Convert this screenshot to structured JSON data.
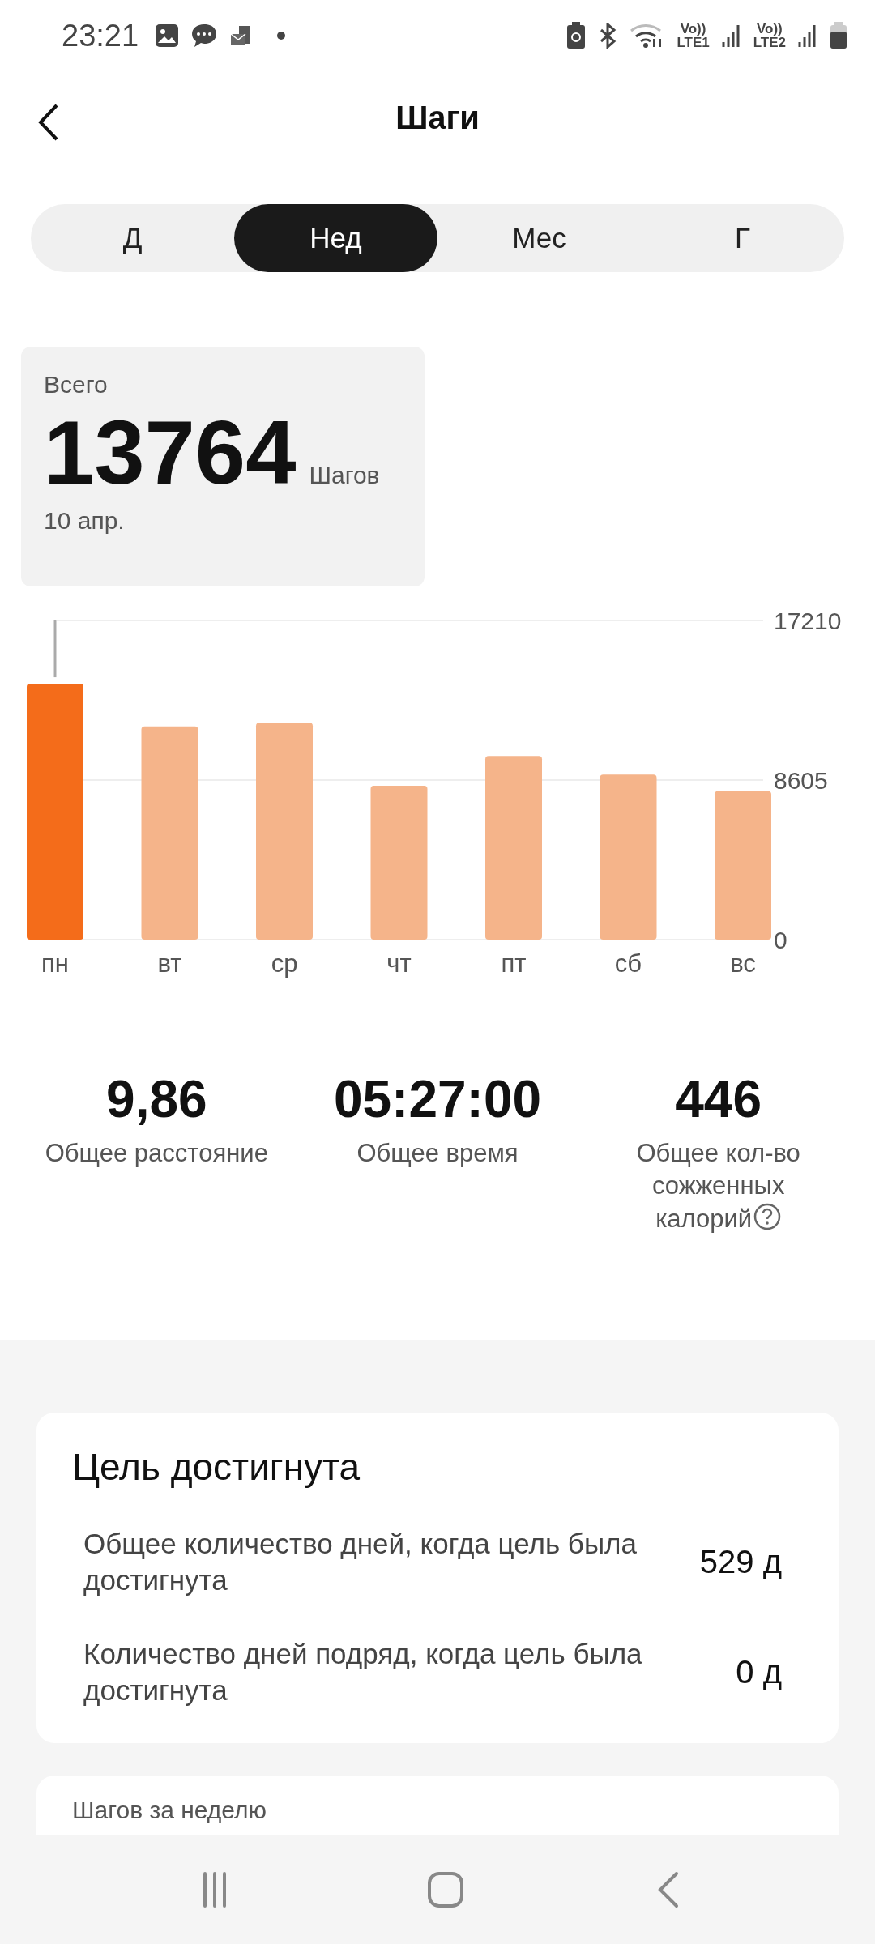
{
  "status_bar": {
    "time": "23:21",
    "network_labels": [
      {
        "top": "Vo))",
        "bottom": "LTE1"
      },
      {
        "top": "Vo))",
        "bottom": "LTE2"
      }
    ]
  },
  "header": {
    "title": "Шаги"
  },
  "tabs": [
    {
      "label": "Д",
      "selected": false
    },
    {
      "label": "Нед",
      "selected": true
    },
    {
      "label": "Мес",
      "selected": false
    },
    {
      "label": "Г",
      "selected": false
    }
  ],
  "summary": {
    "caption": "Всего",
    "value": "13764",
    "unit": "Шагов",
    "date": "10 апр."
  },
  "chart_data": {
    "type": "bar",
    "categories": [
      "пн",
      "вт",
      "ср",
      "чт",
      "пт",
      "сб",
      "вс"
    ],
    "series": [
      {
        "color": "#f46c1a",
        "values": [
          13800,
          null,
          null,
          null,
          null,
          null,
          null
        ]
      },
      {
        "color": "#f5b48a",
        "values": [
          null,
          11500,
          11700,
          8300,
          9900,
          8900,
          8000
        ]
      }
    ],
    "ylim": [
      0,
      17210
    ],
    "yticks": [
      0,
      8605,
      17210
    ]
  },
  "stats": [
    {
      "value": "9,86",
      "label": "Общее расстояние",
      "help": false
    },
    {
      "value": "05:27:00",
      "label": "Общее время",
      "help": false
    },
    {
      "value": "446",
      "label": "Общее кол-во сожженных калорий",
      "help": true
    }
  ],
  "goal_card": {
    "title": "Цель достигнута",
    "rows": [
      {
        "label": "Общее количество дней, когда цель была достигнута",
        "value": "529 д"
      },
      {
        "label": "Количество дней подряд, когда цель была достигнута",
        "value": "0 д"
      }
    ]
  },
  "weekly_card": {
    "title": "Шагов за неделю"
  }
}
